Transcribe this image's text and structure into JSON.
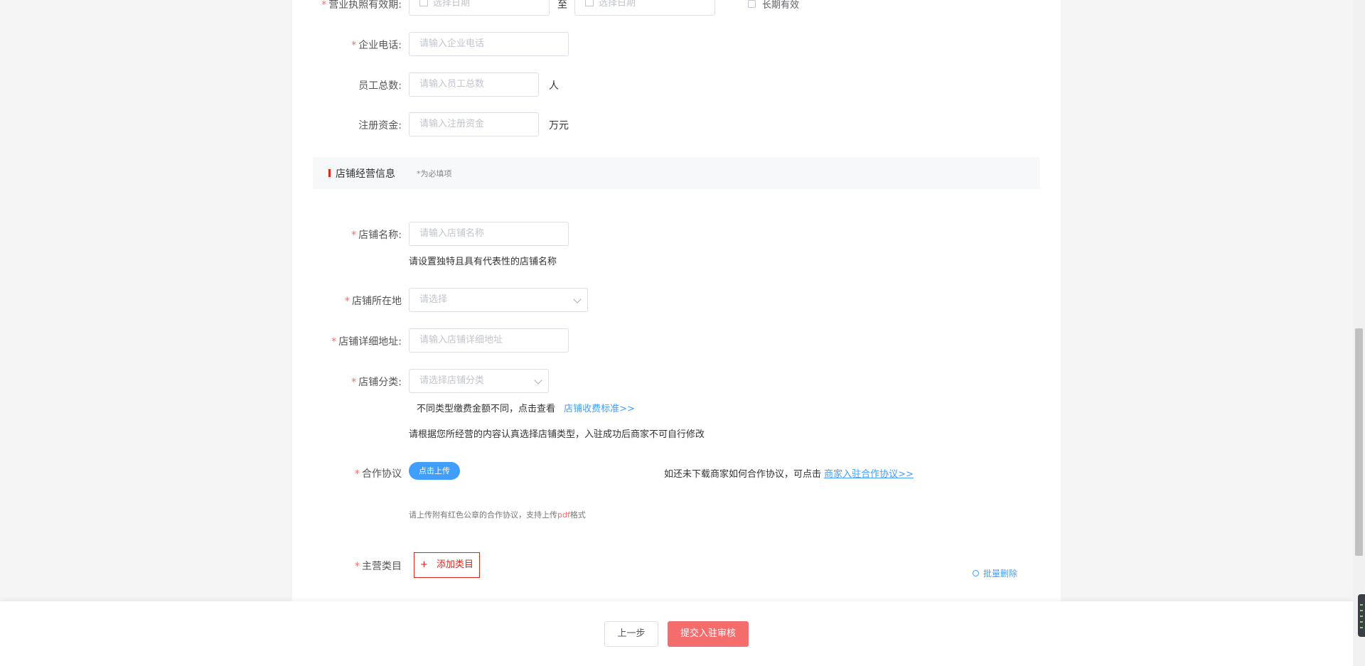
{
  "form": {
    "license_validity": {
      "label": "营业执照有效期:",
      "start_placeholder": "选择日期",
      "separator": "至",
      "end_placeholder": "选择日期",
      "long_term_label": "长期有效"
    },
    "company_phone": {
      "label": "企业电话:",
      "placeholder": "请输入企业电话"
    },
    "employee_count": {
      "label": "员工总数:",
      "placeholder": "请输入员工总数",
      "unit": "人"
    },
    "registered_capital": {
      "label": "注册资金:",
      "placeholder": "请输入注册资金",
      "unit": "万元"
    }
  },
  "section": {
    "title": "店铺经营信息",
    "required_note": "*为必填项"
  },
  "store": {
    "name": {
      "label": "店铺名称:",
      "placeholder": "请输入店铺名称",
      "hint": "请设置独特且具有代表性的店铺名称"
    },
    "location": {
      "label": "店铺所在地",
      "placeholder": "请选择"
    },
    "address": {
      "label": "店铺详细地址:",
      "placeholder": "请输入店铺详细地址"
    },
    "category": {
      "label": "店铺分类:",
      "placeholder": "请选择店铺分类",
      "fee_hint": "不同类型缴费金额不同，点击查看",
      "fee_link": "店铺收费标准>>",
      "hint": "请根据您所经营的内容认真选择店铺类型，入驻成功后商家不可自行修改"
    },
    "agreement": {
      "label": "合作协议",
      "upload_button": "点击上传",
      "download_hint": "如还未下载商家如何合作协议，可点击",
      "download_link": "商家入驻合作协议>>",
      "upload_hint_prefix": "请上传附有红色公章的合作协议，支持上传",
      "upload_hint_format": "pdf",
      "upload_hint_suffix": "格式"
    },
    "main_category": {
      "label": "主营类目",
      "add_button_icon": "+",
      "add_button": "添加类目",
      "batch_delete": "批量删除"
    }
  },
  "footer": {
    "prev_button": "上一步",
    "submit_button": "提交入驻审核"
  },
  "colors": {
    "required": "#f56c6c",
    "accent": "#409eff",
    "brand_red": "#e0231b",
    "submit": "#f56c6c"
  }
}
